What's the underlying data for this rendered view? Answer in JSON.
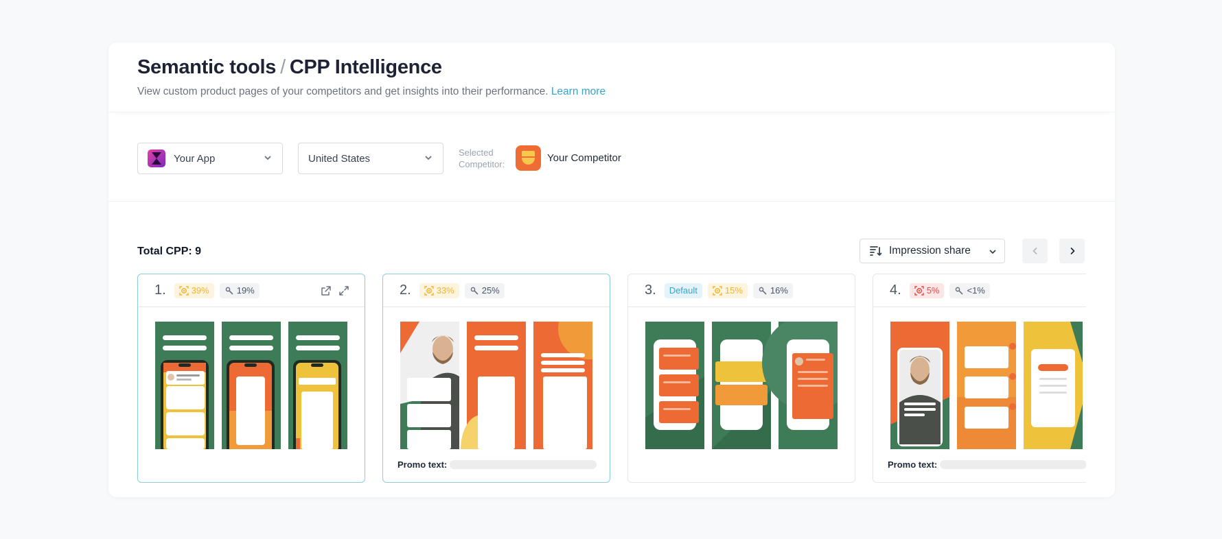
{
  "header": {
    "title_part1": "Semantic tools",
    "title_sep": "/",
    "title_part2": "CPP Intelligence",
    "subtitle": "View custom product pages of your competitors and get insights into their performance.",
    "learn_more": "Learn more"
  },
  "filters": {
    "app_select": "Your App",
    "country_select": "United States",
    "selected_label_line1": "Selected",
    "selected_label_line2": "Competitor:",
    "competitor_name": "Your Competitor"
  },
  "list": {
    "total": "Total CPP: 9",
    "sort_label": "Impression share"
  },
  "cards": [
    {
      "num": "1.",
      "impression": "39%",
      "conversion": "19%",
      "promo_label": ""
    },
    {
      "num": "2.",
      "impression": "33%",
      "conversion": "25%",
      "promo_label": "Promo text:"
    },
    {
      "num": "3.",
      "default_label": "Default",
      "impression": "15%",
      "conversion": "16%",
      "promo_label": ""
    },
    {
      "num": "4.",
      "impression": "5%",
      "conversion": "<1%",
      "promo_label": "Promo text:"
    }
  ],
  "colors": {
    "green": "#3e7b57",
    "orange": "#ee6a35",
    "yellow": "#efc23c",
    "accent": "#3aa3c9"
  },
  "icons": [
    "chevron-down-icon",
    "sort-icon",
    "chevron-left-icon",
    "chevron-right-icon",
    "eye-target-icon",
    "link-icon",
    "external-link-icon",
    "expand-icon"
  ]
}
